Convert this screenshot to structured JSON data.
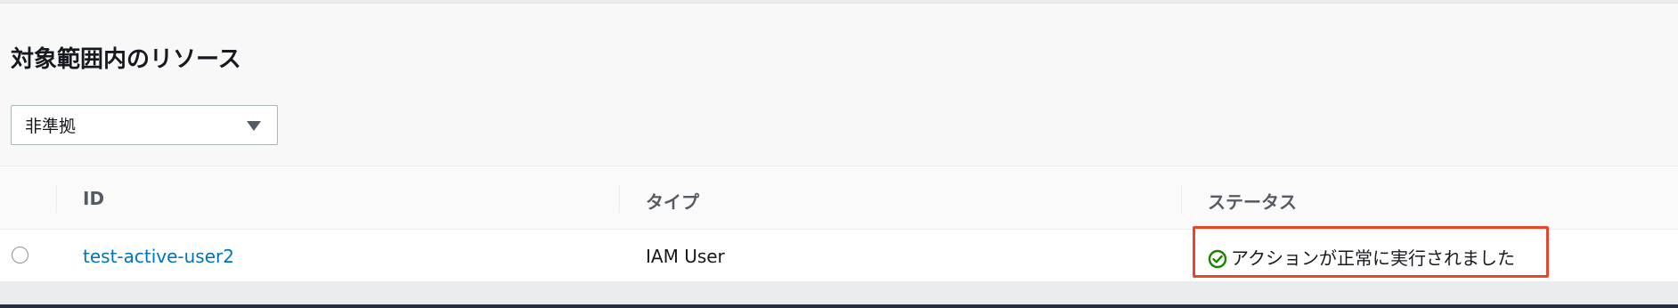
{
  "section": {
    "title": "対象範囲内のリソース"
  },
  "filter": {
    "selected": "非準拠"
  },
  "table": {
    "headers": [
      "ID",
      "タイプ",
      "ステータス"
    ],
    "rows": [
      {
        "id": "test-active-user2",
        "type": "IAM User",
        "status": "アクションが正常に実行されました"
      }
    ]
  },
  "colors": {
    "link": "#0073bb",
    "success": "#1d8102",
    "highlight": "#e8462b"
  },
  "icons": {
    "status": "check-circle-icon",
    "dropdown": "caret-down-icon"
  }
}
